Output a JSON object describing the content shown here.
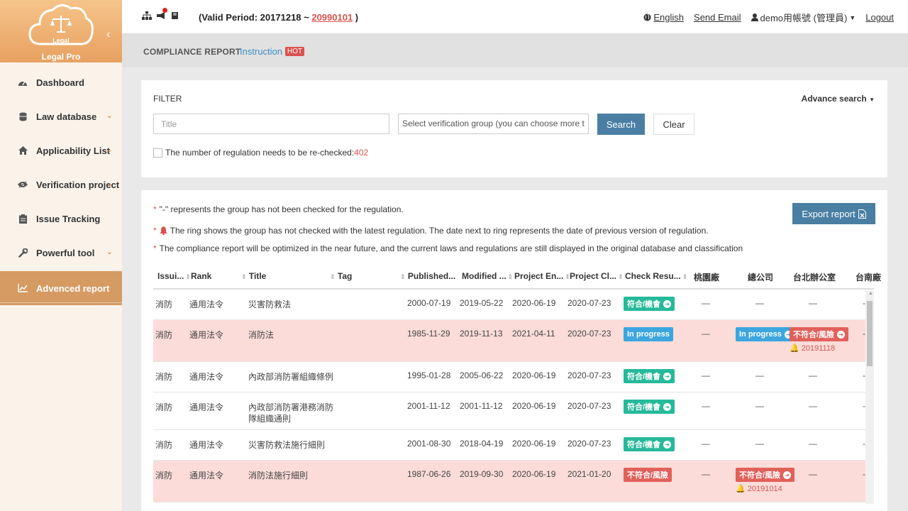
{
  "brand": {
    "logo_text": "Legal",
    "name": "Legal Pro"
  },
  "sidebar": {
    "items": [
      {
        "label": "Dashboard",
        "icon": "dashboard-icon",
        "has_submenu": false
      },
      {
        "label": "Law database",
        "icon": "database-icon",
        "has_submenu": true
      },
      {
        "label": "Applicability List",
        "icon": "home-icon",
        "has_submenu": true
      },
      {
        "label": "Verification project",
        "icon": "eye-icon",
        "has_submenu": true
      },
      {
        "label": "Issue Tracking",
        "icon": "clipboard-icon",
        "has_submenu": false
      },
      {
        "label": "Powerful tool",
        "icon": "wrench-icon",
        "has_submenu": true
      },
      {
        "label": "Advenced report",
        "icon": "line-chart-icon",
        "has_submenu": false,
        "active": true
      }
    ]
  },
  "topbar": {
    "valid_prefix": "(Valid Period: 20171218 ~ ",
    "valid_end": "20990101",
    "valid_suffix": " )",
    "language": "English",
    "send_email": "Send Email",
    "user": "demo用帳號 (管理員)",
    "logout": "Logout"
  },
  "page": {
    "title": "COMPLIANCE REPORT",
    "instruction": "Instruction",
    "hot_badge": "HOT"
  },
  "filter": {
    "label": "FILTER",
    "advance_search": "Advance search",
    "title_placeholder": "Title",
    "group_placeholder": "Select verification group (you can choose more t",
    "search_button": "Search",
    "clear_button": "Clear",
    "recheck_text": "The number of regulation needs to be re-checked:",
    "recheck_count": "402"
  },
  "report": {
    "export_button": "Export report",
    "notes": [
      "\"-\" represents the group has not been checked for the regulation.",
      "The ring shows the group has not checked with the latest regulation. The date next to ring represents the date of previous version of regulation.",
      "The compliance report will be optimized in the near future, and the current laws and regulations are still displayed in the original database and classification"
    ],
    "columns": [
      "Issui...",
      "Rank",
      "Title",
      "Tag",
      "Published...",
      "Modified ...",
      "Project En...",
      "Project Cl...",
      "Check Resu...",
      "桃園廠",
      "總公司",
      "台北辦公室",
      "台南廠"
    ],
    "rows": [
      {
        "issuer": "消防",
        "rank": "通用法令",
        "title": "災害防救法",
        "title2": "",
        "published": "2000-07-19",
        "modified": "2019-05-22",
        "end": "2020-06-19",
        "close": "2020-07-23",
        "result": "符合/機會",
        "result_color": "green",
        "c1": "—",
        "c2": "—",
        "c3": "—",
        "pink": false
      },
      {
        "issuer": "消防",
        "rank": "通用法令",
        "title": "消防法",
        "title2": "",
        "published": "1985-11-29",
        "modified": "2019-11-13",
        "end": "2021-04-11",
        "close": "2020-07-23",
        "result": "In progress",
        "result_color": "blue",
        "c1": "—",
        "c2_badge": "In progress",
        "c3_badge": "不符合/風險",
        "c3_bell": "20191118",
        "pink": true
      },
      {
        "issuer": "消防",
        "rank": "通用法令",
        "title": "內政部消防署組織條例",
        "title2": "",
        "published": "1995-01-28",
        "modified": "2005-06-22",
        "end": "2020-06-19",
        "close": "2020-07-23",
        "result": "符合/機會",
        "result_color": "green",
        "c1": "—",
        "c2": "—",
        "c3": "—",
        "pink": false
      },
      {
        "issuer": "消防",
        "rank": "通用法令",
        "title": "內政部消防署港務消防",
        "title2": "隊組織通則",
        "published": "2001-11-12",
        "modified": "2001-11-12",
        "end": "2020-06-19",
        "close": "2020-07-23",
        "result": "符合/機會",
        "result_color": "green",
        "c1": "—",
        "c2": "—",
        "c3": "—",
        "pink": false
      },
      {
        "issuer": "消防",
        "rank": "通用法令",
        "title": "災害防救法施行細則",
        "title2": "",
        "published": "2001-08-30",
        "modified": "2018-04-19",
        "end": "2020-06-19",
        "close": "2020-07-23",
        "result": "符合/機會",
        "result_color": "green",
        "c1": "—",
        "c2": "—",
        "c3": "—",
        "pink": false
      },
      {
        "issuer": "消防",
        "rank": "通用法令",
        "title": "消防法施行細則",
        "title2": "",
        "published": "1987-06-26",
        "modified": "2019-09-30",
        "end": "2020-06-19",
        "close": "2021-01-20",
        "result": "不符合/風險",
        "result_color": "red",
        "c1": "—",
        "c2_badge": "不符合/風險",
        "c2_bell": "20191014",
        "c3": "—",
        "pink": true
      }
    ]
  },
  "colors": {
    "accent": "#e8a161",
    "primary_button": "#4a7fa3",
    "pink_row": "#fbdcd9",
    "ok": "#26b99a",
    "risk": "#e2605a",
    "progress": "#3da6e0"
  }
}
